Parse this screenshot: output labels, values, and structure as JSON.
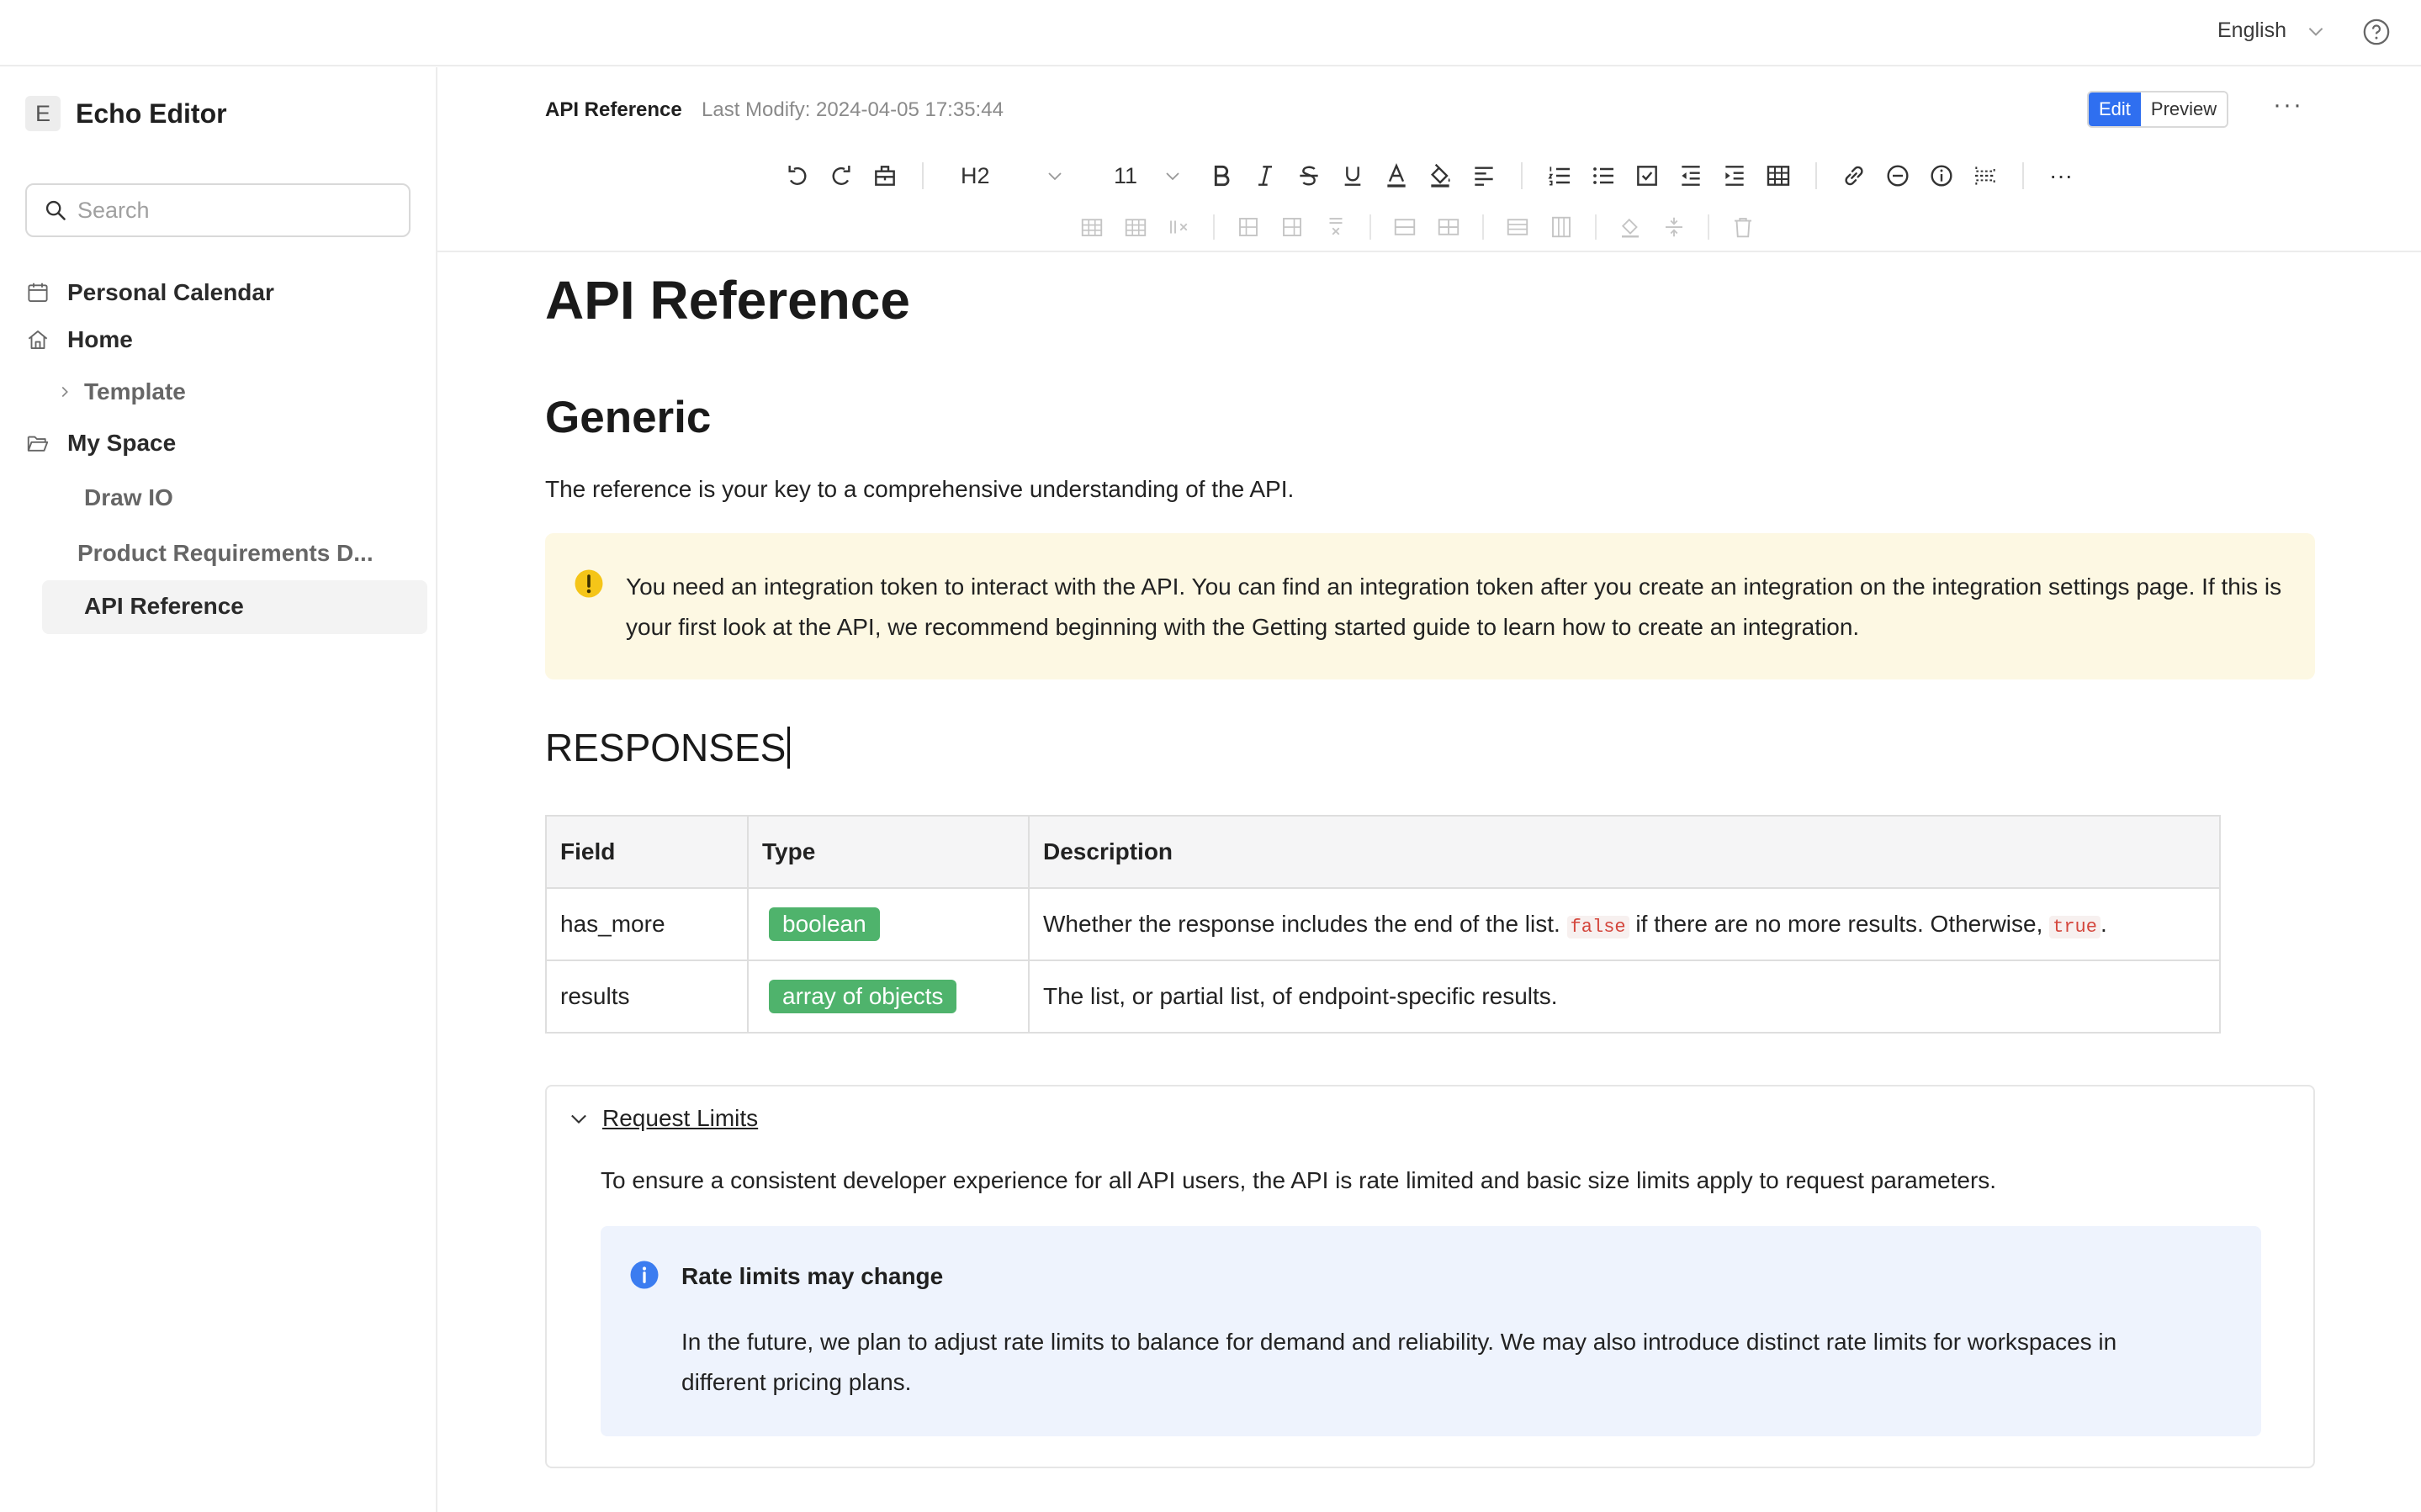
{
  "topbar": {
    "language": "English"
  },
  "sidebar": {
    "logo_letter": "E",
    "app_name": "Echo Editor",
    "search_placeholder": "Search",
    "items": [
      {
        "label": "Personal Calendar",
        "icon": "calendar-icon"
      },
      {
        "label": "Home",
        "icon": "home-icon"
      },
      {
        "label": "Template",
        "icon": "chevron-right-icon"
      },
      {
        "label": "My Space",
        "icon": "folder-open-icon"
      },
      {
        "label": "Draw IO"
      },
      {
        "label": "Product Requirements D..."
      },
      {
        "label": "API Reference",
        "active": true
      }
    ]
  },
  "header": {
    "doc_title": "API Reference",
    "last_modify": "Last Modify: 2024-04-05 17:35:44",
    "edit_label": "Edit",
    "preview_label": "Preview",
    "more": "···"
  },
  "toolbar": {
    "heading_value": "H2",
    "font_size_value": "11",
    "more": "···"
  },
  "document": {
    "title": "API Reference",
    "section_generic": "Generic",
    "intro": "The reference is your key to a comprehensive understanding of the API.",
    "warning": "You need an integration token to interact with the API. You can find an integration token after you create an integration on the integration settings page. If this is your first look at the API, we recommend beginning with the Getting started guide to learn how to create an integration.",
    "responses_heading": "RESPONSES",
    "table": {
      "headers": [
        "Field",
        "Type",
        "Description"
      ],
      "rows": [
        {
          "field": "has_more",
          "type": "boolean",
          "desc_before": "Whether the response includes the end of the list.",
          "code1": "false",
          "desc_middle": "if there are no more results. Otherwise,",
          "code2": "true",
          "desc_after": "."
        },
        {
          "field": "results",
          "type": "array of objects",
          "desc": "The list, or partial list, of endpoint-specific results."
        }
      ]
    },
    "collapse": {
      "title": "Request Limits",
      "text": "To ensure a consistent developer experience for all API users, the API is rate limited and basic size limits apply to request parameters.",
      "callout_title": "Rate limits may change",
      "callout_text": "In the future, we plan to adjust rate limits to balance for demand and reliability. We may also introduce distinct rate limits for workspaces in different pricing plans."
    }
  },
  "colors": {
    "accent": "#2f6ff0",
    "tag_green": "#4fb36c",
    "warning_bg": "#fdf8e3",
    "info_bg": "#eef3fd"
  }
}
